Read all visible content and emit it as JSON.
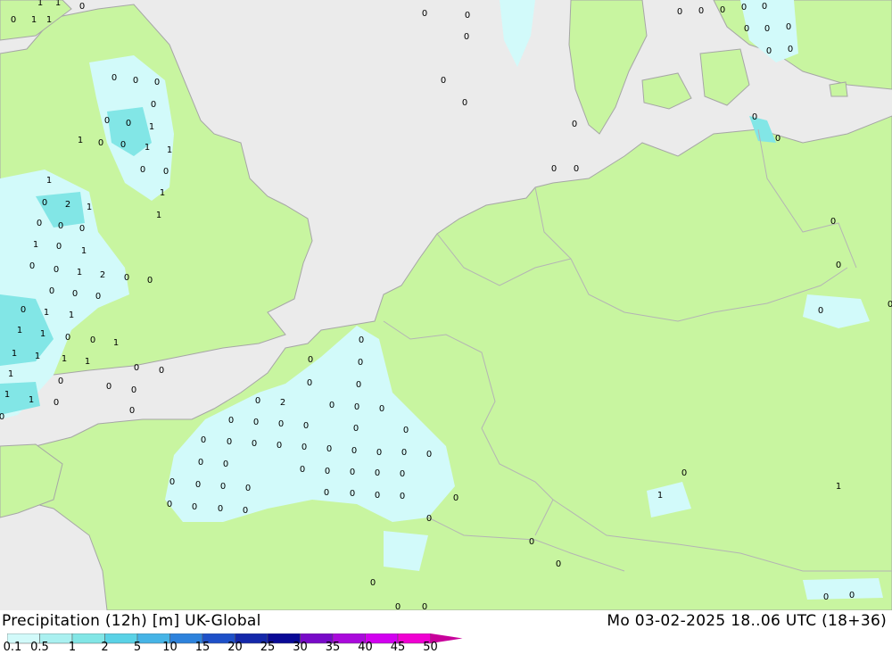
{
  "title": {
    "left": "Precipitation (12h) [m] UK-Global",
    "right": "Mo 03-02-2025 18..06 UTC (18+36)"
  },
  "colors": {
    "sea": "#ebebeb",
    "land": "#c8f5a0",
    "coast": "#a6a6a6",
    "border": "#b4b4b4"
  },
  "legend": {
    "ticks": [
      "0.1",
      "0.5",
      "1",
      "2",
      "5",
      "10",
      "15",
      "20",
      "25",
      "30",
      "35",
      "40",
      "45",
      "50"
    ],
    "colors": [
      "#d2fafa",
      "#aaf0f0",
      "#82e6e6",
      "#5ad2e6",
      "#46b4e6",
      "#2d82dc",
      "#1e50c8",
      "#1428aa",
      "#0a0a96",
      "#780ac8",
      "#aa0adc",
      "#d200f0",
      "#f000d2",
      "#c8009b"
    ]
  },
  "point_values": [
    "0",
    "1",
    "1",
    "0",
    "1",
    "1",
    "0",
    "0",
    "0",
    "0",
    "0",
    "0",
    "1",
    "1",
    "0",
    "0",
    "1",
    "1",
    "0",
    "0",
    "1",
    "1",
    "1",
    "0",
    "2",
    "1",
    "0",
    "0",
    "0",
    "1",
    "0",
    "1",
    "0",
    "0",
    "1",
    "2",
    "0",
    "0",
    "0",
    "0",
    "0",
    "0",
    "1",
    "1",
    "1",
    "1",
    "0",
    "0",
    "1",
    "1",
    "1",
    "1",
    "1",
    "1",
    "0",
    "0",
    "0",
    "1",
    "1",
    "0",
    "0",
    "0",
    "0",
    "0",
    "0",
    "0",
    "0",
    "0",
    "0",
    "0",
    "2",
    "0",
    "0",
    "0",
    "0",
    "0",
    "0",
    "0",
    "0",
    "0",
    "0",
    "0",
    "0",
    "0",
    "0",
    "0",
    "0",
    "0",
    "0",
    "0",
    "0",
    "0",
    "0",
    "0",
    "0",
    "0",
    "0",
    "0",
    "0",
    "0",
    "0",
    "0",
    "0",
    "0",
    "0",
    "0",
    "0",
    "0",
    "0",
    "0",
    "0",
    "0",
    "0",
    "0",
    "0",
    "0",
    "0",
    "0",
    "0",
    "0",
    "0",
    "0",
    "0",
    "0",
    "0",
    "0",
    "0",
    "0",
    "0",
    "0",
    "0",
    "0",
    "0",
    "0",
    "0",
    "0",
    "0",
    "0",
    "0",
    "0",
    "0",
    "1",
    "1",
    "0",
    "0",
    "0",
    "0",
    "0",
    "0",
    "0",
    "0",
    "0",
    "0",
    "0",
    "0",
    "0",
    "0",
    "0",
    "0",
    "0",
    "0",
    "0",
    "0",
    "0",
    "0",
    "0",
    "0",
    "0",
    "0",
    "0",
    "0",
    "0",
    "0",
    "0",
    "0",
    "0",
    "0",
    "0",
    "0",
    "0",
    "0",
    "0",
    "0",
    "0",
    "0",
    "0",
    "0",
    "0",
    "0",
    "0",
    "0",
    "0",
    "0",
    "0",
    "0",
    "0",
    "0"
  ]
}
